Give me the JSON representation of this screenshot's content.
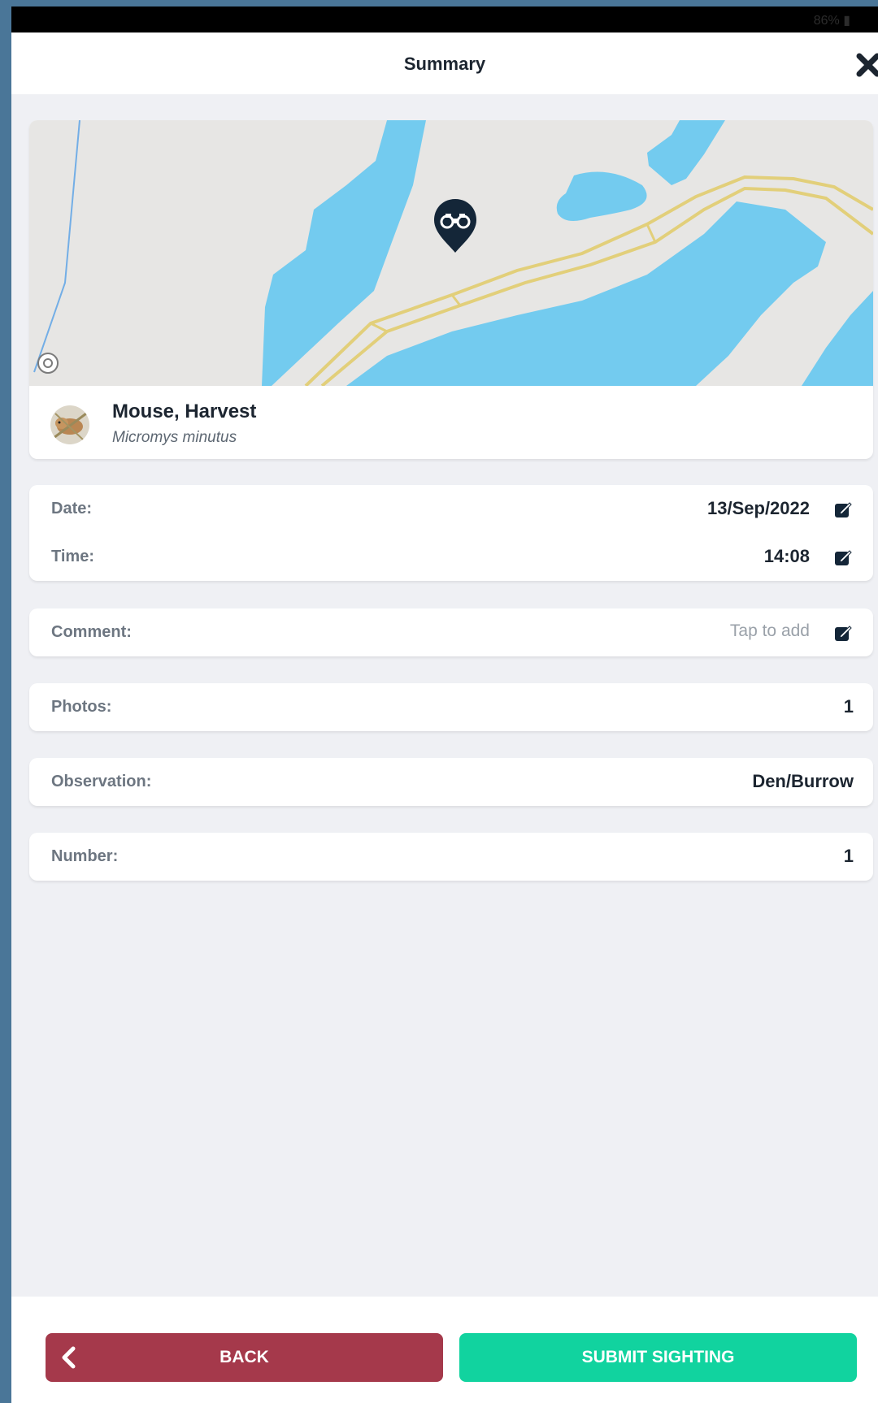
{
  "status_bar": {
    "battery": "86% ▮"
  },
  "header": {
    "title": "Summary",
    "close_icon": "close-icon"
  },
  "map": {
    "marker_icon": "binoculars-icon",
    "locate_icon": "locate-icon"
  },
  "species": {
    "name": "Mouse, Harvest",
    "latin": "Micromys minutus",
    "avatar_icon": "harvest-mouse-photo"
  },
  "details": {
    "date_label": "Date:",
    "date_value": "13/Sep/2022",
    "time_label": "Time:",
    "time_value": "14:08",
    "comment_label": "Comment:",
    "comment_placeholder": "Tap to add",
    "photos_label": "Photos:",
    "photos_value": "1",
    "observation_label": "Observation:",
    "observation_value": "Den/Burrow",
    "number_label": "Number:",
    "number_value": "1"
  },
  "footer": {
    "back_label": "BACK",
    "submit_label": "SUBMIT SIGHTING"
  },
  "colors": {
    "water": "#73cbef",
    "land": "#e7e6e4",
    "road": "#e2cf7a",
    "back_button": "#a5394b",
    "submit_button": "#11d39f",
    "dark": "#1c2530"
  }
}
